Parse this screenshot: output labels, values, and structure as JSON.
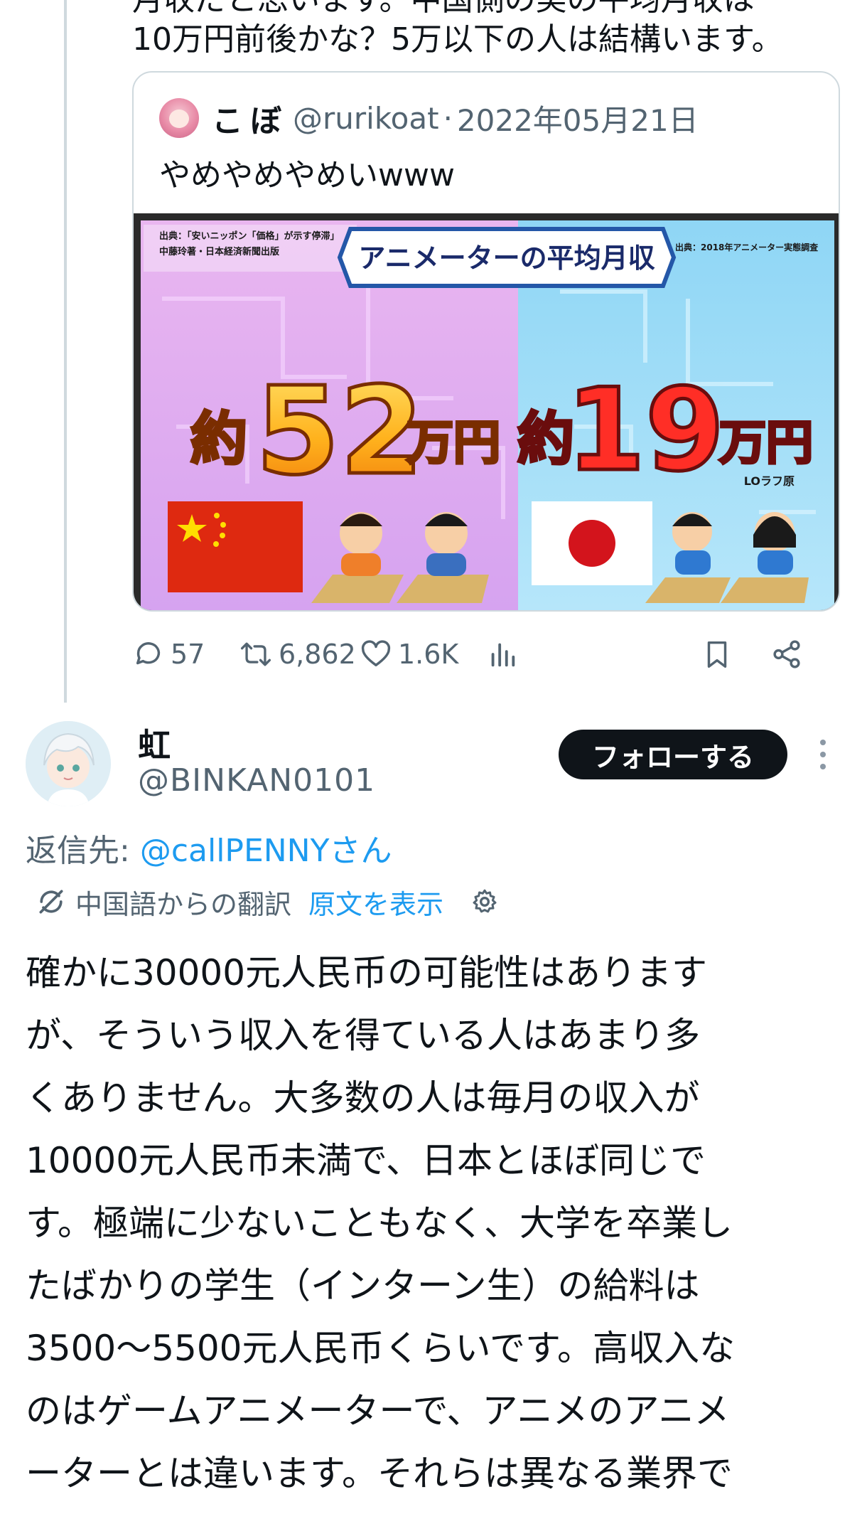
{
  "previous_post": {
    "lines": [
      "月収だと思います。中国側の美の平均月収は",
      "10万円前後かな？5万以下の人は結構います。"
    ]
  },
  "quoted_post": {
    "display_name": "こぼ",
    "handle": "@rurikoat",
    "separator": "·",
    "date": "2022年05月21日",
    "text": "やめやめやめいwww",
    "image": {
      "title": "アニメーターの平均月収",
      "source_left_line1": "出典：「安いニッポン「価格」が示す停滞」",
      "source_left_line2": "中藤玲著・日本経済新聞出版",
      "source_right": "出典：2018年アニメーター実態調査",
      "left_prefix": "約",
      "left_value": "52",
      "left_unit": "万円",
      "right_prefix": "約",
      "right_value": "19",
      "right_unit": "万円",
      "watermark": "LOラフ原"
    }
  },
  "actions": {
    "replies": "57",
    "reposts": "6,862",
    "likes": "1.6K"
  },
  "reply": {
    "display_name": "虹",
    "handle": "@BINKAN0101",
    "follow_label": "フォローする",
    "reply_to_prefix": "返信先: ",
    "reply_to_user": "@callPENNYさん",
    "translation_note": "中国語からの翻訳",
    "show_original": "原文を表示",
    "body_lines": [
      "確かに30000元人民币の可能性はあります",
      "が、そういう収入を得ている人はあまり多",
      "くありません。大多数の人は毎月の収入が",
      "10000元人民币未満で、日本とほぼ同じで",
      "す。極端に少ないこともなく、大学を卒業し",
      "たばかりの学生（インターン生）の給料は",
      "3500〜5500元人民币くらいです。高収入な",
      "のはゲームアニメーターで、アニメのアニメ",
      "ーターとは違います。それらは異なる業界で"
    ]
  },
  "colors": {
    "text": "#0f1419",
    "secondary": "#536471",
    "link": "#1d9bf0",
    "border": "#cfd9de",
    "follow_bg": "#0f1419"
  }
}
